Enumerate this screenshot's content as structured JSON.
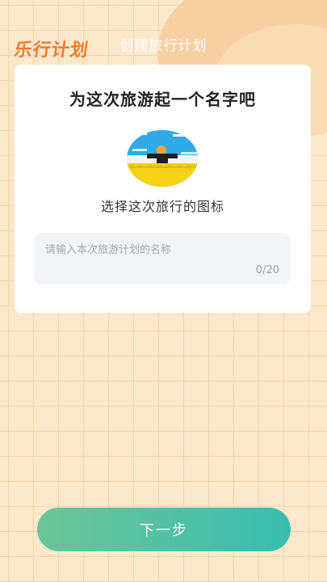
{
  "header": {
    "logo_text": "乐行计划",
    "title": "创建旅行计划"
  },
  "card": {
    "title": "为这次旅游起一个名字吧",
    "icon_label": "选择这次旅行的图标",
    "name_input": {
      "placeholder": "请输入本次旅游计划的名称",
      "value": "",
      "counter": "0/20"
    }
  },
  "footer": {
    "next_label": "下一步"
  },
  "icons": {
    "trip_icon": "beach-sunset-icon"
  },
  "colors": {
    "logo": "#ef7a2c",
    "button_start": "#6cc598",
    "button_end": "#39bdb0",
    "background": "#fbe8cb"
  }
}
